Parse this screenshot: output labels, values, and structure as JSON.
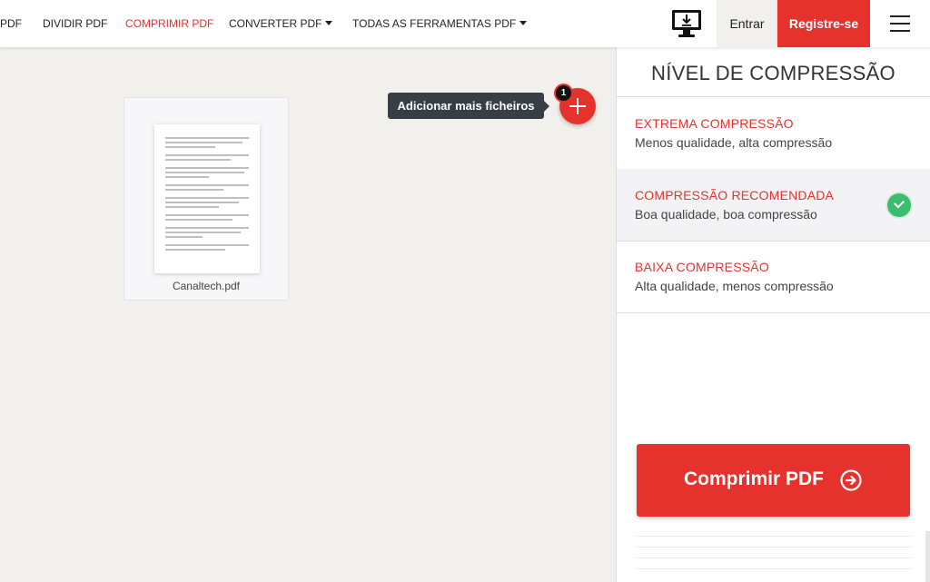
{
  "nav": {
    "items": [
      {
        "label": "PDF",
        "active": false,
        "dropdown": false
      },
      {
        "label": "DIVIDIR PDF",
        "active": false,
        "dropdown": false
      },
      {
        "label": "COMPRIMIR PDF",
        "active": true,
        "dropdown": false
      },
      {
        "label": "CONVERTER PDF",
        "active": false,
        "dropdown": true
      },
      {
        "label": "TODAS AS FERRAMENTAS PDF",
        "active": false,
        "dropdown": true
      }
    ],
    "desktop_icon": "desktop-download-icon",
    "login_label": "Entrar",
    "register_label": "Registre-se",
    "menu_icon": "hamburger-icon"
  },
  "workspace": {
    "file": {
      "name": "Canaltech.pdf"
    },
    "add_tooltip": "Adicionar mais ficheiros",
    "file_count": "1",
    "add_icon": "plus-icon"
  },
  "panel": {
    "title": "NÍVEL DE COMPRESSÃO",
    "options": [
      {
        "title": "EXTREMA COMPRESSÃO",
        "desc": "Menos qualidade, alta compressão",
        "selected": false
      },
      {
        "title": "COMPRESSÃO RECOMENDADA",
        "desc": "Boa qualidade, boa compressão",
        "selected": true
      },
      {
        "title": "BAIXA COMPRESSÃO",
        "desc": "Alta qualidade, menos compressão",
        "selected": false
      }
    ],
    "submit_label": "Comprimir PDF",
    "submit_icon": "arrow-circle-right-icon"
  },
  "colors": {
    "accent": "#e5322d",
    "check": "#3cbc6f",
    "tooltip_bg": "#383e45",
    "workspace_bg": "#f2f0ed"
  }
}
